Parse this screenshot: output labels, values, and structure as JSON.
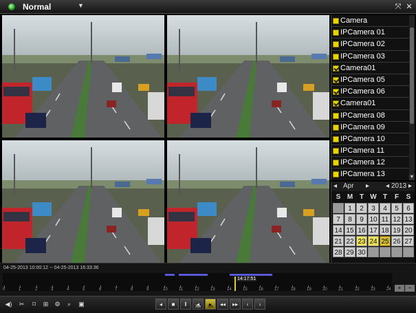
{
  "title_bar": {
    "mode": "Normal",
    "icons": [
      "record-indicator-icon",
      "dropdown-caret-icon",
      "fullscreen-icon",
      "close-icon"
    ]
  },
  "cameras": {
    "header": "Camera",
    "items": [
      {
        "label": "IPCamera 01",
        "checked": false
      },
      {
        "label": "IPCamera 02",
        "checked": false
      },
      {
        "label": "IPCamera 03",
        "checked": false
      },
      {
        "label": "Camera01",
        "checked": true
      },
      {
        "label": "IPCamera 05",
        "checked": true
      },
      {
        "label": "IPCamera 06",
        "checked": true
      },
      {
        "label": "Camera01",
        "checked": true
      },
      {
        "label": "IPCamera 08",
        "checked": false
      },
      {
        "label": "IPCamera 09",
        "checked": false
      },
      {
        "label": "IPCamera 10",
        "checked": false
      },
      {
        "label": "IPCamera 11",
        "checked": false
      },
      {
        "label": "IPCamera 12",
        "checked": false
      },
      {
        "label": "IPCamera 13",
        "checked": false
      }
    ]
  },
  "calendar": {
    "month": "Apr",
    "year": "2013",
    "weekdays": [
      "S",
      "M",
      "T",
      "W",
      "T",
      "F",
      "S"
    ],
    "lead_blanks": 1,
    "days": 30,
    "trail_blanks": 4,
    "recorded_days": [
      23,
      24,
      25
    ],
    "selected_day": 25
  },
  "timeline": {
    "range": "04-25-2013 10:00:12 -- 04-25-2013 16:33:36",
    "ticks": [
      "0",
      "1",
      "2",
      "3",
      "4",
      "5",
      "6",
      "7",
      "8",
      "9",
      "10",
      "11",
      "12",
      "13",
      "14",
      "15",
      "16",
      "17",
      "18",
      "19",
      "20",
      "21",
      "22",
      "23",
      "24"
    ],
    "current_time": "14:17:51",
    "zoom_in": "+",
    "zoom_out": "−"
  },
  "toolbar": {
    "tools": [
      "audio-icon",
      "clip-icon",
      "tag-icon",
      "bookmark-icon",
      "settings-icon",
      "search-zoom-icon",
      "snapshot-icon"
    ],
    "playback": [
      {
        "name": "reverse-play-button",
        "glyph": "◂",
        "sub": ""
      },
      {
        "name": "stop-button",
        "glyph": "■",
        "sub": ""
      },
      {
        "name": "pause-button",
        "glyph": "‖",
        "sub": ""
      },
      {
        "name": "back-30s-button",
        "glyph": "◂",
        "sub": "30s"
      },
      {
        "name": "forward-30s-button",
        "glyph": "▸",
        "sub": "30s",
        "active": true
      },
      {
        "name": "slow-button",
        "glyph": "◂◂",
        "sub": ""
      },
      {
        "name": "fast-button",
        "glyph": "▸▸",
        "sub": ""
      },
      {
        "name": "previous-button",
        "glyph": "‹",
        "sub": ""
      },
      {
        "name": "next-button",
        "glyph": "›",
        "sub": ""
      }
    ]
  },
  "colors": {
    "record_green": "#1c9a1c",
    "camera_yellow": "#e8d400",
    "recorded_day": "#ece25a",
    "record_segment": "#5858d8",
    "cursor": "#e6d200"
  }
}
